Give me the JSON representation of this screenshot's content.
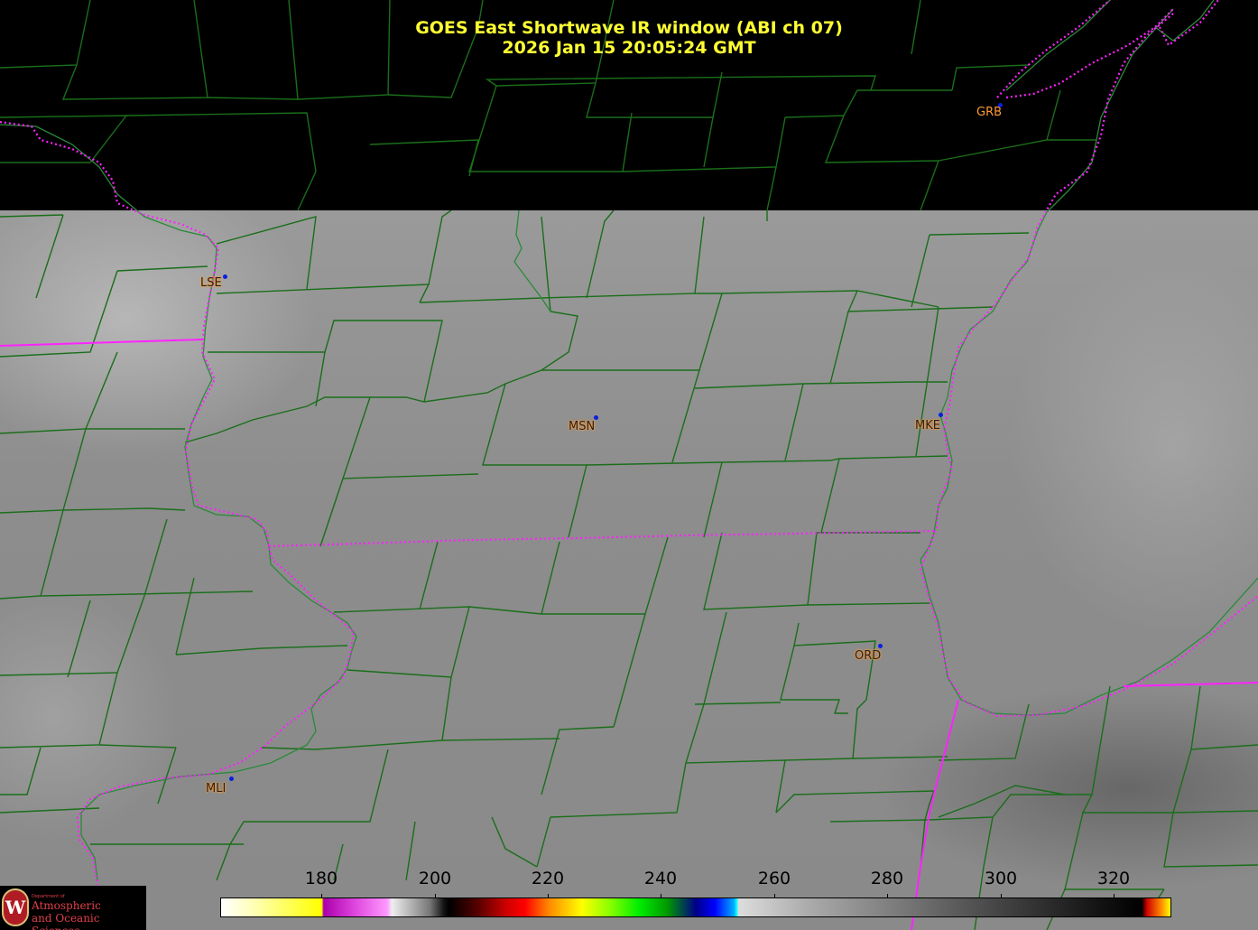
{
  "title": {
    "line1": "GOES East Shortwave IR window (ABI ch 07)",
    "line2": "2026 Jan 15  20:05:24 GMT"
  },
  "stations": [
    {
      "id": "grb",
      "label": "GRB"
    },
    {
      "id": "lse",
      "label": "LSE"
    },
    {
      "id": "msn",
      "label": "MSN"
    },
    {
      "id": "mke",
      "label": "MKE"
    },
    {
      "id": "ord",
      "label": "ORD"
    },
    {
      "id": "mli",
      "label": "MLI"
    }
  ],
  "colorbar": {
    "ticks": [
      "180",
      "200",
      "220",
      "240",
      "260",
      "280",
      "300",
      "320"
    ]
  },
  "logo": {
    "department": "Department of",
    "line1": "Atmospheric",
    "line2": "and Oceanic Sciences",
    "shield_letter": "W"
  },
  "colors": {
    "title": "#ffff33",
    "county_lines": "#1a6e1a",
    "state_lines": "#ff22ff",
    "station_label": "#ff9933",
    "station_dot": "#0a1fe0"
  }
}
